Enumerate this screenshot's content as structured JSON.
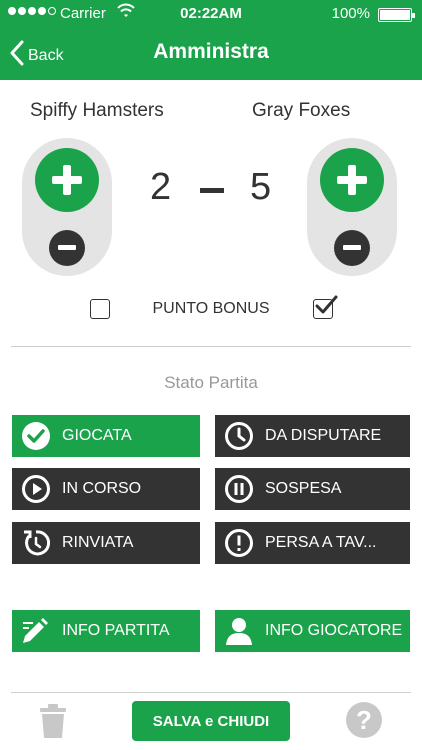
{
  "status_bar": {
    "carrier": "Carrier",
    "time": "02:22AM",
    "battery": "100%"
  },
  "nav": {
    "back_label": "Back",
    "title": "Amministra"
  },
  "match": {
    "home_team": "Spiffy Hamsters",
    "away_team": "Gray Foxes",
    "home_score": "2",
    "away_score": "5",
    "home_bonus_checked": false,
    "away_bonus_checked": true,
    "bonus_label": "PUNTO BONUS"
  },
  "status_section": {
    "title": "Stato Partita",
    "buttons": [
      {
        "label": "GIOCATA",
        "icon": "check-circle-icon",
        "selected": true
      },
      {
        "label": "DA DISPUTARE",
        "icon": "clock-icon",
        "selected": false
      },
      {
        "label": "IN CORSO",
        "icon": "play-icon",
        "selected": false
      },
      {
        "label": "SOSPESA",
        "icon": "pause-icon",
        "selected": false
      },
      {
        "label": "RINVIATA",
        "icon": "postpone-icon",
        "selected": false
      },
      {
        "label": "PERSA A TAV...",
        "icon": "alert-icon",
        "selected": false
      }
    ]
  },
  "info": {
    "match_info": "INFO PARTITA",
    "player_info": "INFO GIOCATORE"
  },
  "footer": {
    "save_label": "SALVA e CHIUDI",
    "help_label": "?"
  },
  "colors": {
    "accent": "#1aa34a",
    "dark": "#333333",
    "capsule": "#e4e4e4"
  }
}
